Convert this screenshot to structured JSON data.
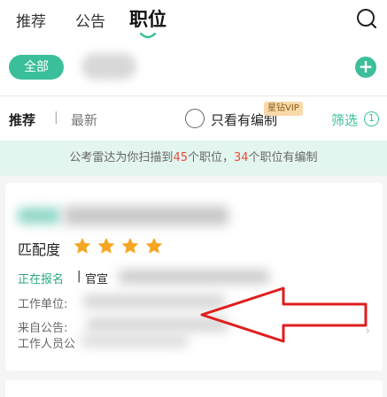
{
  "nav": {
    "tabs": [
      {
        "label": "推荐"
      },
      {
        "label": "公告"
      },
      {
        "label": "职位"
      }
    ],
    "active": "职位",
    "search_icon": "search-icon"
  },
  "categories": {
    "all_label": "全部",
    "add_icon": "plus-icon",
    "accent_color": "#3bbf9a"
  },
  "filters": {
    "recommend": "推荐",
    "separator": "|",
    "latest": "最新",
    "only_label": "只看有编制",
    "vip_tag": "星钻VIP",
    "screen_label": "筛选",
    "info_icon": "info-icon"
  },
  "banner": {
    "prefix": "公考雷达为你扫描到",
    "count_total": "45",
    "mid": "个职位，",
    "count_staffed": "34",
    "suffix": "个职位有编制"
  },
  "card": {
    "match_label": "匹配度",
    "stars": 4,
    "status": "正在报名",
    "status_sep": "|",
    "official": "官宣",
    "unit_label": "工作单位:",
    "from_label": "来自公告:",
    "staff_label": "工作人员公"
  }
}
